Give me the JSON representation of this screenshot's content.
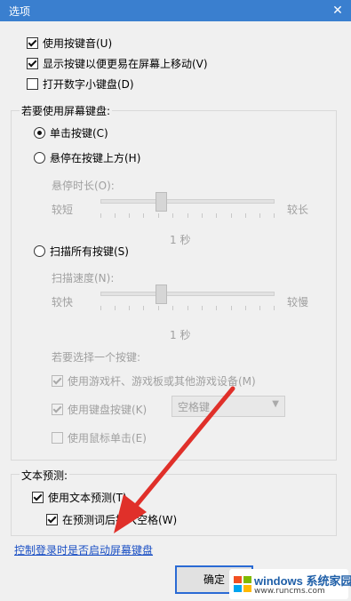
{
  "window": {
    "title": "选项",
    "close_glyph": "✕"
  },
  "keyboard_options": {
    "click_sound": {
      "label": "使用按键音(U)",
      "checked": true
    },
    "show_keys": {
      "label": "显示按键以便更易在屏幕上移动(V)",
      "checked": true
    },
    "numeric_pad": {
      "label": "打开数字小键盘(D)",
      "checked": false
    }
  },
  "usage_group": {
    "legend": "若要使用屏幕键盘:",
    "click_keys": {
      "label": "单击按键(C)",
      "selected": true
    },
    "hover_keys": {
      "label": "悬停在按键上方(H)",
      "selected": false
    },
    "hover_duration": {
      "label": "悬停时长(O):",
      "min_label": "较短",
      "max_label": "较长",
      "value_text": "1 秒"
    },
    "scan_keys": {
      "label": "扫描所有按键(S)",
      "selected": false
    },
    "scan_speed": {
      "label": "扫描速度(N):",
      "min_label": "较快",
      "max_label": "较慢",
      "value_text": "1 秒"
    },
    "select_key_label": "若要选择一个按键:",
    "use_gamepad": {
      "label": "使用游戏杆、游戏板或其他游戏设备(M)",
      "checked": true
    },
    "use_keyboard_key": {
      "label": "使用键盘按键(K)",
      "checked": true
    },
    "keyboard_key_select": {
      "value": "空格键"
    },
    "use_mouse_click": {
      "label": "使用鼠标单击(E)",
      "checked": false
    }
  },
  "prediction_group": {
    "legend": "文本预测:",
    "use_prediction": {
      "label": "使用文本预测(T)",
      "checked": true
    },
    "insert_space": {
      "label": "在预测词后插入空格(W)",
      "checked": true
    }
  },
  "footer": {
    "login_link": "控制登录时是否启动屏幕键盘",
    "ok_button": "确定"
  },
  "watermark": {
    "line1": "windows",
    "line2": "系统家园",
    "url": "www.runcms.com"
  },
  "colors": {
    "titlebar": "#3a7fcf",
    "annotation_arrow": "#e0302a",
    "link": "#1a4fc4"
  }
}
